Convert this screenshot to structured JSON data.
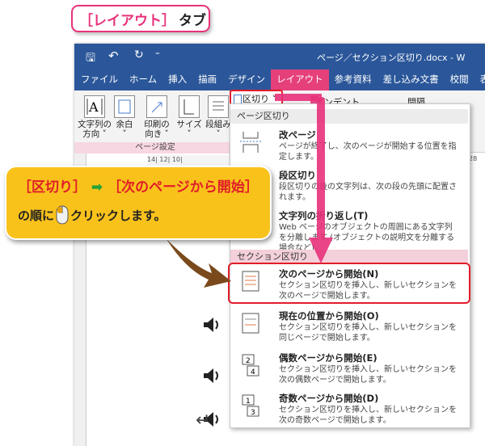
{
  "callout_tab": {
    "bracket_text": "［レイアウト］",
    "suffix": "タブ"
  },
  "titlebar": {
    "title": "ページ／セクション区切り.docx - W",
    "quick_access": {
      "save": "🖫",
      "undo": "↶",
      "redo": "↻",
      "customize": "⁼"
    }
  },
  "ribbon_tabs": [
    "ファイル",
    "ホーム",
    "挿入",
    "描画",
    "デザイン",
    "レイアウト",
    "参考資料",
    "差し込み文書",
    "校閲",
    "表示"
  ],
  "ribbon": {
    "buttons": [
      {
        "line1": "文字列の",
        "line2": "方向 ˅"
      },
      {
        "line1": "余白",
        "line2": "˅"
      },
      {
        "line1": "印刷の",
        "line2": "向き ˅"
      },
      {
        "line1": "サイズ",
        "line2": "˅"
      },
      {
        "line1": "段組み",
        "line2": "˅"
      }
    ],
    "breaks_label": "区切り ˅",
    "indent_label": "インデント",
    "spacing_label": "間隔",
    "group_label": "ページ設定",
    "ruler_text": "14| 12| 10|",
    "ruler_right": "28"
  },
  "menu": {
    "page_header": "ページ区切り",
    "section_header": "セクション区切り",
    "page_items": [
      {
        "title": "改ページ",
        "desc": "ページが終了し、次のページが開始する位置を指定します。"
      },
      {
        "title": "段区切り",
        "desc": "段区切りの後の文字列は、次の段の先頭に配置されます。"
      },
      {
        "title": "文字列の折り返し(T)",
        "desc": "Web ページのオブジェクトの周囲にある文字列を分離します (オブジェクトの説明文を分離する場合など)。"
      }
    ],
    "section_items": [
      {
        "title": "次のページから開始(N)",
        "desc": "セクション区切りを挿入し、新しいセクションを次のページで開始します。"
      },
      {
        "title": "現在の位置から開始(O)",
        "desc": "セクション区切りを挿入し、新しいセクションを同じページで開始します。"
      },
      {
        "title": "偶数ページから開始(E)",
        "desc": "セクション区切りを挿入し、新しいセクションを次の偶数ページで開始します。"
      },
      {
        "title": "奇数ページから開始(D)",
        "desc": "セクション区切りを挿入し、新しいセクションを次の奇数ページで開始します。"
      }
    ]
  },
  "callout_instruction": {
    "part1": "［区切り］",
    "arrow": "➡",
    "part2": "［次のページから開始］",
    "line2_prefix": "の順に",
    "line2_suffix": "クリックします。"
  },
  "doc": {
    "return_mark": "↵"
  },
  "colors": {
    "word_blue": "#2b579a",
    "active_tab": "#e5407a",
    "highlight_red": "#e21c2a",
    "callout_yellow": "#f9c21b",
    "pink_arrow": "#e8327a"
  }
}
